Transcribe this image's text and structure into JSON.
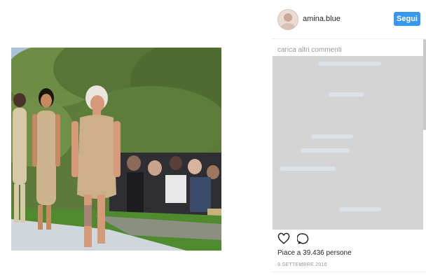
{
  "post": {
    "username": "amina.blue",
    "follow_label": "Segui",
    "load_more_label": "carica altri commenti",
    "likes_text": "Piace a 39.436 persone",
    "date_text": "9 SETTEMBRE 2016"
  },
  "icons": {
    "avatar": "profile-avatar",
    "like": "heart-outline-icon",
    "comment": "speech-bubble-icon"
  },
  "colors": {
    "follow_button": "#3897f0",
    "muted_text": "#999999"
  }
}
